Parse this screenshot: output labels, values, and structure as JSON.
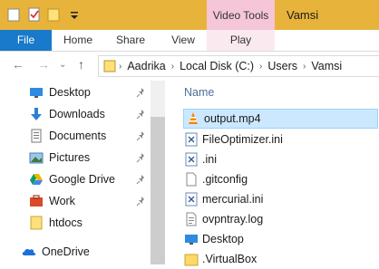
{
  "titlebar": {
    "contextual_tab": "Video Tools",
    "window_title": "Vamsi"
  },
  "ribbon": {
    "tabs": [
      "File",
      "Home",
      "Share",
      "View",
      "Play"
    ]
  },
  "address": {
    "path": [
      "Aadrika",
      "Local Disk (C:)",
      "Users",
      "Vamsi"
    ]
  },
  "navigation": {
    "items": [
      {
        "label": "Desktop",
        "icon": "desktop-icon",
        "pinned": true
      },
      {
        "label": "Downloads",
        "icon": "download-icon",
        "pinned": true
      },
      {
        "label": "Documents",
        "icon": "documents-icon",
        "pinned": true
      },
      {
        "label": "Pictures",
        "icon": "pictures-icon",
        "pinned": true
      },
      {
        "label": "Google Drive",
        "icon": "google-drive-icon",
        "pinned": true
      },
      {
        "label": "Work",
        "icon": "briefcase-icon",
        "pinned": true
      },
      {
        "label": "htdocs",
        "icon": "folder-icon",
        "pinned": false
      },
      {
        "label": "OneDrive",
        "icon": "onedrive-icon",
        "pinned": false
      }
    ]
  },
  "content": {
    "column_header": "Name",
    "files": [
      {
        "name": "output.mp4",
        "icon": "vlc-icon",
        "selected": true
      },
      {
        "name": "FileOptimizer.ini",
        "icon": "ini-file-icon",
        "selected": false
      },
      {
        "name": ".ini",
        "icon": "ini-file-icon",
        "selected": false
      },
      {
        "name": ".gitconfig",
        "icon": "file-icon",
        "selected": false
      },
      {
        "name": "mercurial.ini",
        "icon": "ini-file-icon",
        "selected": false
      },
      {
        "name": "ovpntray.log",
        "icon": "log-file-icon",
        "selected": false
      },
      {
        "name": "Desktop",
        "icon": "desktop-folder-icon",
        "selected": false
      },
      {
        "name": ".VirtualBox",
        "icon": "folder-icon",
        "selected": false
      }
    ]
  },
  "colors": {
    "titlebar": "#e8b33a",
    "file_tab": "#1979ca",
    "video_tools": "#f5c6d8",
    "selection": "#cce8ff"
  }
}
